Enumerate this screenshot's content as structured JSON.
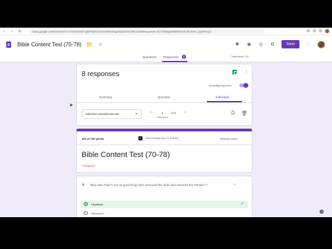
{
  "browser": {
    "url": "docs.google.com/forms/d/1YCV2Iw1Ro4tTq00PtkBUOm4VW6kvKkgwn2pMGuO0tEJ/edit#response=ACYDBNgk9kBRWGzKZKvtWw_Qy5EmQQ"
  },
  "app": {
    "doc_title": "Bible Content Test (70-78)",
    "send_label": "Send"
  },
  "tabs": {
    "questions": "Questions",
    "responses": "Responses",
    "responses_count": "8",
    "total_points": "Total points: 100"
  },
  "summary_card": {
    "title": "8 responses",
    "accepting_label": "Accepting responses",
    "subtabs": [
      "Summary",
      "Question",
      "Individual"
    ],
    "email_selected": "katherine.clark@email.com",
    "page_current": "1",
    "page_of": "of   8"
  },
  "response_card": {
    "points": "100 of 100 points",
    "released_note": "Score released Apr 11 9:36 AM",
    "release_score_label": "Release score",
    "quiz_title": "Bible Content Test (70-78)",
    "required_note": "* Required"
  },
  "question_card": {
    "question": "Who was Ahaz's son (a good king) who removed the idols and restored the Temple? *",
    "score": "1/1",
    "options": [
      {
        "label": "Hezekiah",
        "selected": true,
        "correct": true
      },
      {
        "label": "Manasseh",
        "selected": false,
        "correct": false
      }
    ]
  },
  "colors": {
    "accent": "#673ab7",
    "background": "#f0ebf8",
    "correct": "#1e8e3e"
  }
}
